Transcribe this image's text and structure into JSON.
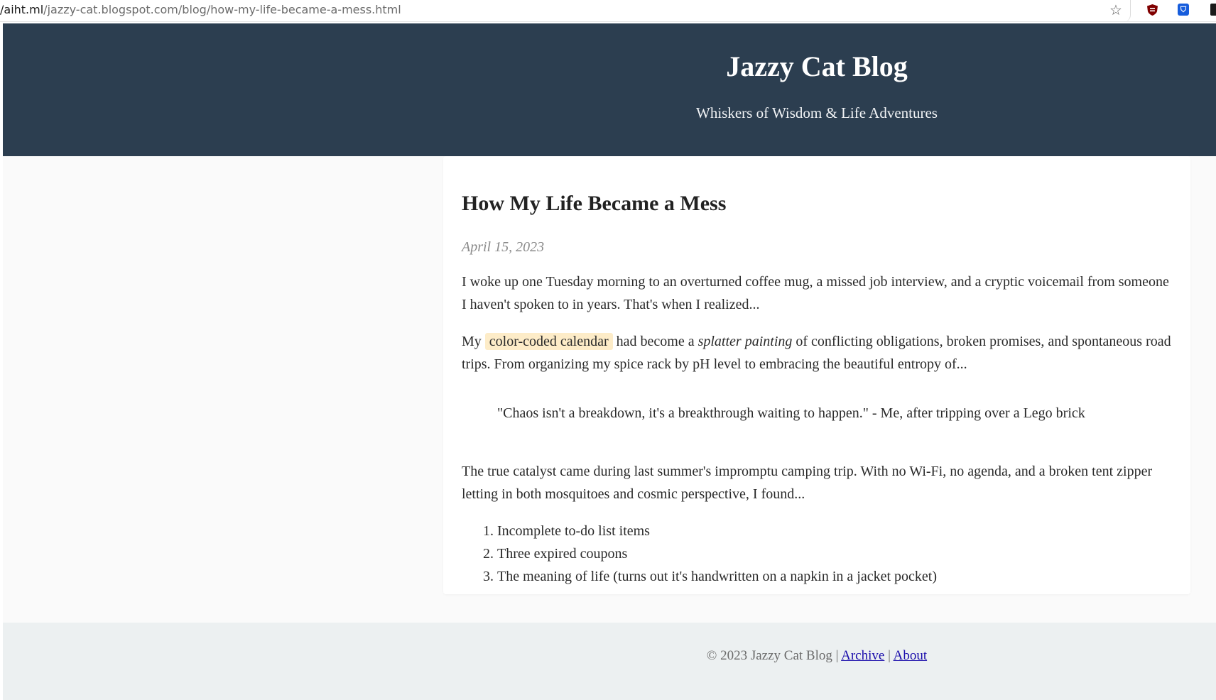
{
  "browser": {
    "url_domain": "/aiht.ml",
    "url_path": "/jazzy-cat.blogspot.com/blog/how-my-life-became-a-mess.html",
    "icons": [
      "star-icon",
      "ublock-origin-icon",
      "bitwarden-icon"
    ]
  },
  "header": {
    "title": "Jazzy Cat Blog",
    "tagline": "Whiskers of Wisdom & Life Adventures"
  },
  "post": {
    "title": "How My Life Became a Mess",
    "date": "April 15, 2023",
    "p1": "I woke up one Tuesday morning to an overturned coffee mug, a missed job interview, and a cryptic voicemail from someone I haven't spoken to in years. That's when I realized...",
    "p2_before": "My ",
    "p2_highlight": "color-coded calendar",
    "p2_middle": " had become a ",
    "p2_emphasis": "splatter painting",
    "p2_after": " of conflicting obligations, broken promises, and spontaneous road trips. From organizing my spice rack by pH level to embracing the beautiful entropy of...",
    "quote": "\"Chaos isn't a breakdown, it's a breakthrough waiting to happen.\" - Me, after tripping over a Lego brick",
    "p4": "The true catalyst came during last summer's impromptu camping trip. With no Wi-Fi, no agenda, and a broken tent zipper letting in both mosquitoes and cosmic perspective, I found...",
    "list": [
      "Incomplete to-do list items",
      "Three expired coupons",
      "The meaning of life (turns out it's handwritten on a napkin in a jacket pocket)"
    ]
  },
  "footer": {
    "copyright": "© 2023 Jazzy Cat Blog |",
    "separator": "|",
    "archive_label": "Archive",
    "about_label": "About"
  },
  "colors": {
    "header_bg": "#2c3e50",
    "footer_bg": "#ecf0f1",
    "highlight_bg": "#fdecc8",
    "link": "#1a0dab"
  }
}
